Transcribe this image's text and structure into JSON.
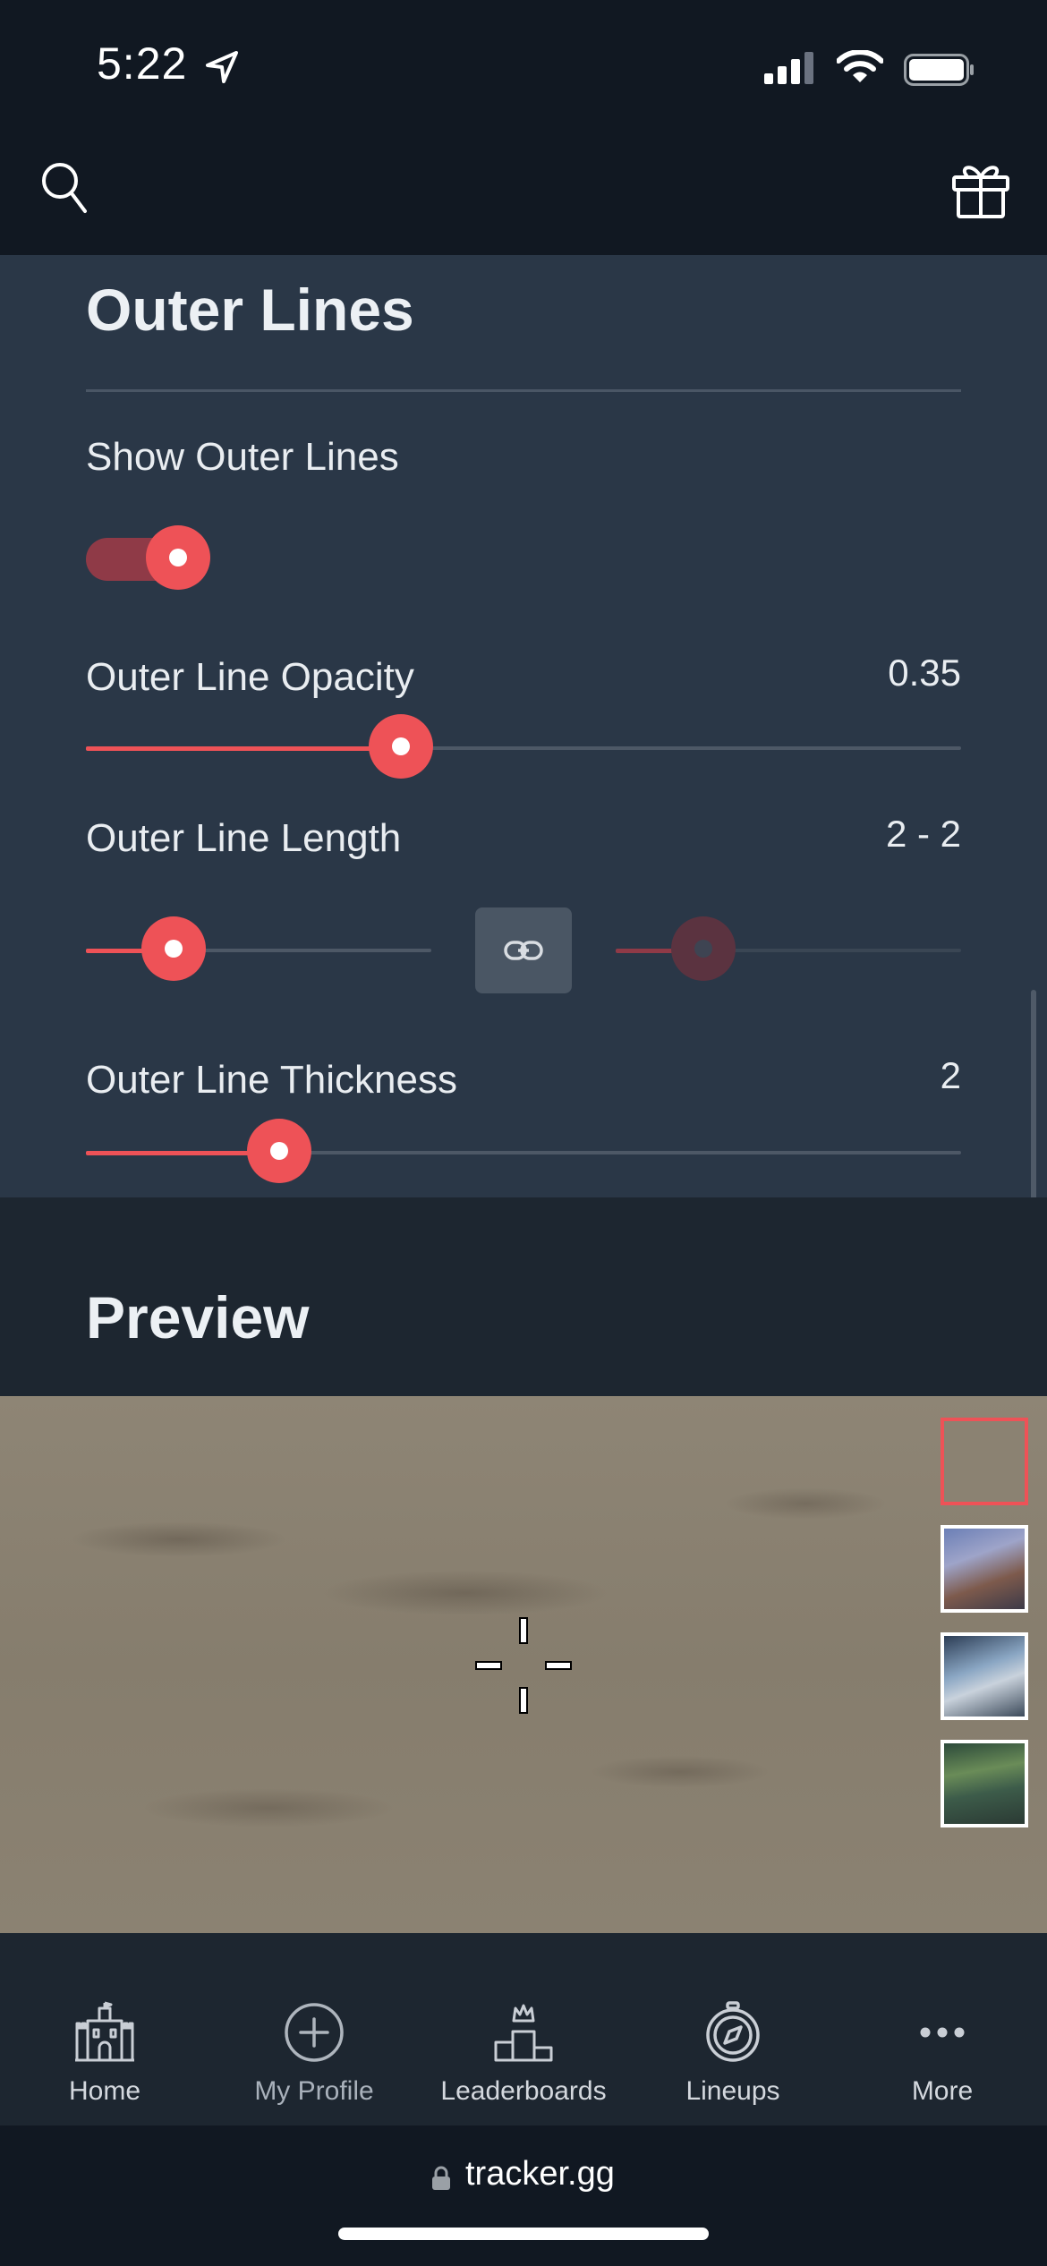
{
  "status_bar": {
    "time": "5:22"
  },
  "section": {
    "title": "Outer Lines",
    "show_outer_lines": {
      "label": "Show Outer Lines",
      "enabled": true
    },
    "opacity": {
      "label": "Outer Line Opacity",
      "value": "0.35",
      "fraction": 0.35
    },
    "length": {
      "label": "Outer Line Length",
      "value": "2 - 2"
    },
    "thickness": {
      "label": "Outer Line Thickness",
      "value": "2"
    }
  },
  "preview": {
    "title": "Preview"
  },
  "tabs": [
    {
      "label": "Home",
      "icon": "castle-icon"
    },
    {
      "label": "My Profile",
      "icon": "plus-circle-icon"
    },
    {
      "label": "Leaderboards",
      "icon": "podium-icon"
    },
    {
      "label": "Lineups",
      "icon": "compass-icon"
    },
    {
      "label": "More",
      "icon": "more-dots-icon"
    }
  ],
  "browser": {
    "url": "tracker.gg"
  },
  "colors": {
    "accent": "#ee5257",
    "card": "#2a3747",
    "background": "#111822"
  }
}
